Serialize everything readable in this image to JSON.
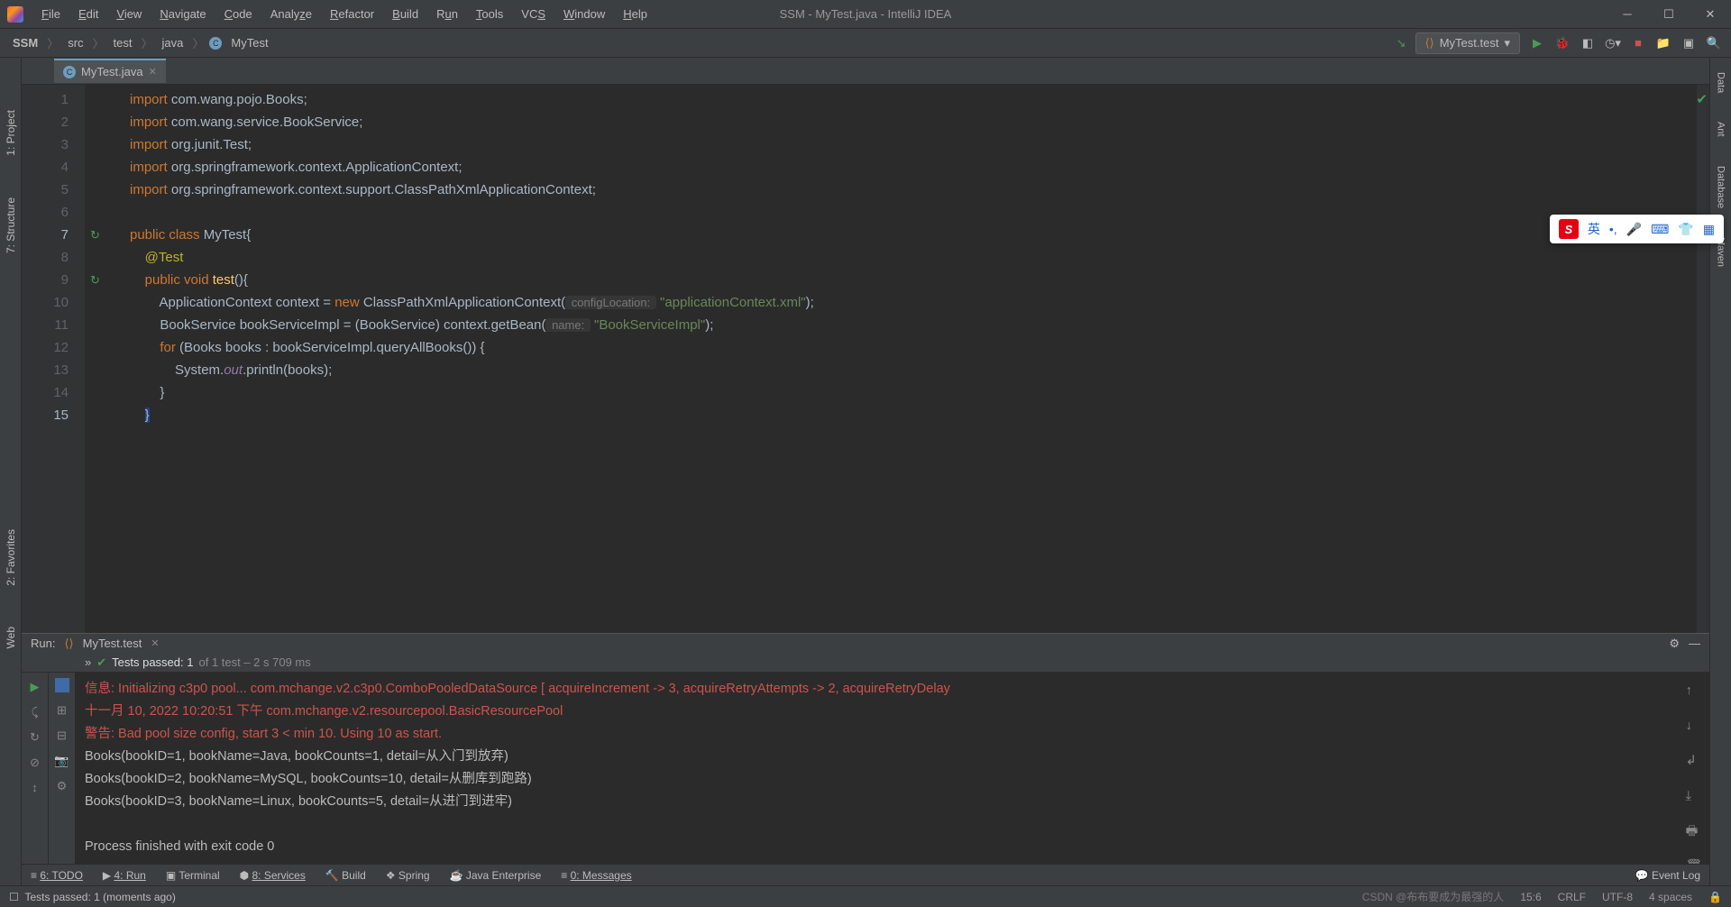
{
  "window": {
    "title": "SSM - MyTest.java - IntelliJ IDEA"
  },
  "menus": [
    "File",
    "Edit",
    "View",
    "Navigate",
    "Code",
    "Analyze",
    "Refactor",
    "Build",
    "Run",
    "Tools",
    "VCS",
    "Window",
    "Help"
  ],
  "breadcrumbs": {
    "project": "SSM",
    "items": [
      "src",
      "test",
      "java",
      "MyTest"
    ]
  },
  "runconfig": {
    "label": "MyTest.test"
  },
  "tab": {
    "name": "MyTest.java"
  },
  "left_tools": {
    "project": "1: Project",
    "structure": "7: Structure",
    "favorites": "2: Favorites",
    "web": "Web"
  },
  "right_tools": {
    "data": "Data",
    "ant": "Ant",
    "database": "Database",
    "maven": "Maven"
  },
  "code_lines": [
    {
      "n": 1,
      "kw": "import",
      "rest": " com.wang.pojo.Books;"
    },
    {
      "n": 2,
      "kw": "import",
      "rest": " com.wang.service.BookService;"
    },
    {
      "n": 3,
      "kw": "import",
      "rest": " org.junit.Test;"
    },
    {
      "n": 4,
      "kw": "import",
      "rest": " org.springframework.context.ApplicationContext;"
    },
    {
      "n": 5,
      "kw": "import",
      "rest": " org.springframework.context.support.ClassPathXmlApplicationContext;"
    }
  ],
  "code": {
    "class_decl_kw": "public class ",
    "class_name": "MyTest",
    "class_open": "{",
    "anno": "@Test",
    "method_kw": "public void ",
    "method_name": "test",
    "method_sig": "(){",
    "l10a": "ApplicationContext context = ",
    "l10new": "new ",
    "l10b": "ClassPathXmlApplicationContext(",
    "l10hint": " configLocation: ",
    "l10str": "\"applicationContext.xml\"",
    "l10c": ");",
    "l11a": "BookService bookServiceImpl = (BookService) context.getBean(",
    "l11hint": " name: ",
    "l11str": "\"BookServiceImpl\"",
    "l11b": ");",
    "l12kw": "for ",
    "l12a": "(Books books : bookServiceImpl.queryAllBooks()) {",
    "l13a": "System.",
    "l13out": "out",
    "l13b": ".println(books);",
    "l14": "}",
    "l15": "}"
  },
  "run": {
    "label": "Run:",
    "tab": "MyTest.test",
    "tests_pass_prefix": "Tests passed: 1",
    "tests_pass_suffix": " of 1 test – 2 s 709 ms",
    "console": {
      "l1": "信息: Initializing c3p0 pool... com.mchange.v2.c3p0.ComboPooledDataSource [ acquireIncrement -> 3, acquireRetryAttempts -> 2, acquireRetryDelay",
      "l2a": "十一月 10, 2022 10:20:51 下午 ",
      "l2b": "com.mchange.v2.resourcepool.BasicResourcePool",
      "l3": "警告: Bad pool size config, start 3 < min 10. Using 10 as start.",
      "l4": "Books(bookID=1, bookName=Java, bookCounts=1, detail=从入门到放弃)",
      "l5": "Books(bookID=2, bookName=MySQL, bookCounts=10, detail=从删库到跑路)",
      "l6": "Books(bookID=3, bookName=Linux, bookCounts=5, detail=从进门到进牢)",
      "l7": "Process finished with exit code 0"
    }
  },
  "bottom": {
    "todo": "6: TODO",
    "run": "4: Run",
    "terminal": "Terminal",
    "services": "8: Services",
    "build": "Build",
    "spring": "Spring",
    "javaee": "Java Enterprise",
    "messages": "0: Messages",
    "eventlog": "Event Log"
  },
  "status": {
    "msg": "Tests passed: 1 (moments ago)",
    "pos": "15:6",
    "crlf": "CRLF",
    "enc": "UTF-8",
    "indent": "4 spaces",
    "watermark": "CSDN @布布要成为最强的人"
  },
  "ime": {
    "lang": "英"
  }
}
